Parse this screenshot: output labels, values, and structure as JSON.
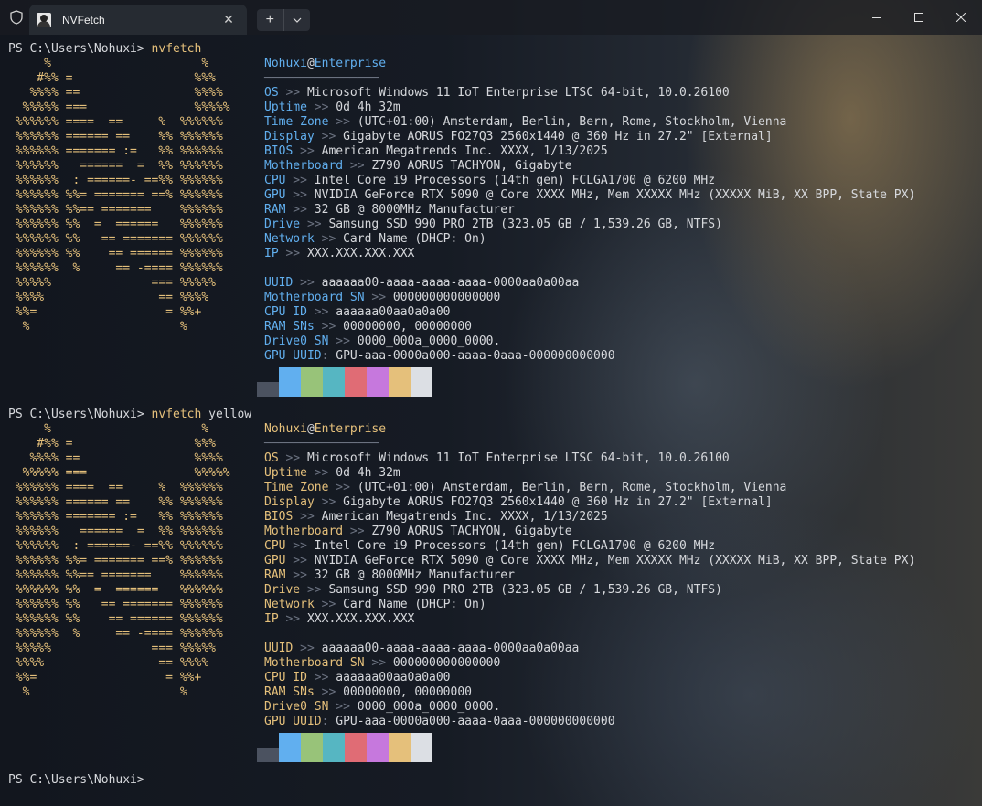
{
  "window": {
    "tab_title": "NVFetch",
    "new_tab_symbol": "+",
    "dropdown_symbol": "⌄",
    "close_tab_symbol": "✕",
    "minimize_symbol": "─",
    "maximize_symbol": "☐",
    "close_symbol": "✕"
  },
  "blocks": [
    {
      "prompt": "PS C:\\Users\\Nohuxi> ",
      "command": "nvfetch",
      "args": "",
      "accent": "#61afef",
      "ascii": [
        "     %                     %",
        "    #%% =                 %%%",
        "   %%%% ==                %%%%",
        "  %%%%% ===               %%%%%",
        " %%%%%% ====  ==     %  %%%%%%",
        " %%%%%% ====== ==    %% %%%%%%",
        " %%%%%% ======= :=   %% %%%%%%",
        " %%%%%%   ======  =  %% %%%%%%",
        " %%%%%%  : ======- ==%% %%%%%%",
        " %%%%%% %%= ======= ==% %%%%%%",
        " %%%%%% %%== =======    %%%%%%",
        " %%%%%% %%  =  ======   %%%%%%",
        " %%%%%% %%   == ======= %%%%%%",
        " %%%%%% %%    == ====== %%%%%%",
        " %%%%%%  %     == -==== %%%%%%",
        " %%%%%              === %%%%%",
        " %%%%                == %%%%",
        " %%=                  = %%+",
        "  %                     %"
      ],
      "user": "Nohuxi",
      "at": "@",
      "host": "Enterprise",
      "divider": "────────────────",
      "info": [
        {
          "label": "OS",
          "sep": " >> ",
          "value": "Microsoft Windows 11 IoT Enterprise LTSC 64-bit, 10.0.26100"
        },
        {
          "label": "Uptime",
          "sep": " >> ",
          "value": "0d 4h 32m"
        },
        {
          "label": "Time Zone",
          "sep": " >> ",
          "value": "(UTC+01:00) Amsterdam, Berlin, Bern, Rome, Stockholm, Vienna"
        },
        {
          "label": "Display",
          "sep": " >> ",
          "value": "Gigabyte AORUS FO27Q3 2560x1440 @ 360 Hz in 27.2\" [External]"
        },
        {
          "label": "BIOS",
          "sep": " >> ",
          "value": "American Megatrends Inc. XXXX, 1/13/2025"
        },
        {
          "label": "Motherboard",
          "sep": " >> ",
          "value": "Z790 AORUS TACHYON, Gigabyte"
        },
        {
          "label": "CPU",
          "sep": " >> ",
          "value": "Intel Core i9 Processors (14th gen) FCLGA1700 @ 6200 MHz"
        },
        {
          "label": "GPU",
          "sep": " >> ",
          "value": "NVIDIA GeForce RTX 5090 @ Core XXXX MHz, Mem XXXXX MHz (XXXXX MiB, XX BPP, State PX)"
        },
        {
          "label": "RAM",
          "sep": " >> ",
          "value": "32 GB @ 8000MHz Manufacturer"
        },
        {
          "label": "Drive",
          "sep": " >> ",
          "value": "Samsung SSD 990 PRO 2TB (323.05 GB / 1,539.26 GB, NTFS)"
        },
        {
          "label": "Network",
          "sep": " >> ",
          "value": "Card Name (DHCP: On)"
        },
        {
          "label": "IP",
          "sep": " >> ",
          "value": "XXX.XXX.XXX.XXX"
        }
      ],
      "ids": [
        {
          "label": "UUID",
          "sep": " >> ",
          "value": "aaaaaa00-aaaa-aaaa-aaaa-0000aa0a00aa"
        },
        {
          "label": "Motherboard SN",
          "sep": " >> ",
          "value": "000000000000000"
        },
        {
          "label": "CPU ID",
          "sep": " >> ",
          "value": "aaaaaa00aa0a0a00"
        },
        {
          "label": "RAM SNs",
          "sep": " >> ",
          "value": "00000000, 00000000"
        },
        {
          "label": "Drive0 SN",
          "sep": " >> ",
          "value": "0000_000a_0000_0000."
        },
        {
          "label": "GPU UUID",
          "sep": ": ",
          "value": "GPU-aaa-0000a000-aaaa-0aaa-000000000000"
        }
      ]
    },
    {
      "prompt": "PS C:\\Users\\Nohuxi> ",
      "command": "nvfetch",
      "args": " yellow",
      "accent": "#e5c07b",
      "ascii": [
        "     %                     %",
        "    #%% =                 %%%",
        "   %%%% ==                %%%%",
        "  %%%%% ===               %%%%%",
        " %%%%%% ====  ==     %  %%%%%%",
        " %%%%%% ====== ==    %% %%%%%%",
        " %%%%%% ======= :=   %% %%%%%%",
        " %%%%%%   ======  =  %% %%%%%%",
        " %%%%%%  : ======- ==%% %%%%%%",
        " %%%%%% %%= ======= ==% %%%%%%",
        " %%%%%% %%== =======    %%%%%%",
        " %%%%%% %%  =  ======   %%%%%%",
        " %%%%%% %%   == ======= %%%%%%",
        " %%%%%% %%    == ====== %%%%%%",
        " %%%%%%  %     == -==== %%%%%%",
        " %%%%%              === %%%%%",
        " %%%%                == %%%%",
        " %%=                  = %%+",
        "  %                     %"
      ],
      "user": "Nohuxi",
      "at": "@",
      "host": "Enterprise",
      "divider": "────────────────",
      "info": [
        {
          "label": "OS",
          "sep": " >> ",
          "value": "Microsoft Windows 11 IoT Enterprise LTSC 64-bit, 10.0.26100"
        },
        {
          "label": "Uptime",
          "sep": " >> ",
          "value": "0d 4h 32m"
        },
        {
          "label": "Time Zone",
          "sep": " >> ",
          "value": "(UTC+01:00) Amsterdam, Berlin, Bern, Rome, Stockholm, Vienna"
        },
        {
          "label": "Display",
          "sep": " >> ",
          "value": "Gigabyte AORUS FO27Q3 2560x1440 @ 360 Hz in 27.2\" [External]"
        },
        {
          "label": "BIOS",
          "sep": " >> ",
          "value": "American Megatrends Inc. XXXX, 1/13/2025"
        },
        {
          "label": "Motherboard",
          "sep": " >> ",
          "value": "Z790 AORUS TACHYON, Gigabyte"
        },
        {
          "label": "CPU",
          "sep": " >> ",
          "value": "Intel Core i9 Processors (14th gen) FCLGA1700 @ 6200 MHz"
        },
        {
          "label": "GPU",
          "sep": " >> ",
          "value": "NVIDIA GeForce RTX 5090 @ Core XXXX MHz, Mem XXXXX MHz (XXXXX MiB, XX BPP, State PX)"
        },
        {
          "label": "RAM",
          "sep": " >> ",
          "value": "32 GB @ 8000MHz Manufacturer"
        },
        {
          "label": "Drive",
          "sep": " >> ",
          "value": "Samsung SSD 990 PRO 2TB (323.05 GB / 1,539.26 GB, NTFS)"
        },
        {
          "label": "Network",
          "sep": " >> ",
          "value": "Card Name (DHCP: On)"
        },
        {
          "label": "IP",
          "sep": " >> ",
          "value": "XXX.XXX.XXX.XXX"
        }
      ],
      "ids": [
        {
          "label": "UUID",
          "sep": " >> ",
          "value": "aaaaaa00-aaaa-aaaa-aaaa-0000aa0a00aa"
        },
        {
          "label": "Motherboard SN",
          "sep": " >> ",
          "value": "000000000000000"
        },
        {
          "label": "CPU ID",
          "sep": " >> ",
          "value": "aaaaaa00aa0a0a00"
        },
        {
          "label": "RAM SNs",
          "sep": " >> ",
          "value": "00000000, 00000000"
        },
        {
          "label": "Drive0 SN",
          "sep": " >> ",
          "value": "0000_000a_0000_0000."
        },
        {
          "label": "GPU UUID",
          "sep": ": ",
          "value": "GPU-aaa-0000a000-aaaa-0aaa-000000000000"
        }
      ]
    }
  ],
  "palette": [
    "#4b5260",
    "#61afef",
    "#98c379",
    "#56b6c2",
    "#e06c75",
    "#c678dd",
    "#e5c07b",
    "#dcdfe4"
  ],
  "final_prompt": "PS C:\\Users\\Nohuxi> "
}
